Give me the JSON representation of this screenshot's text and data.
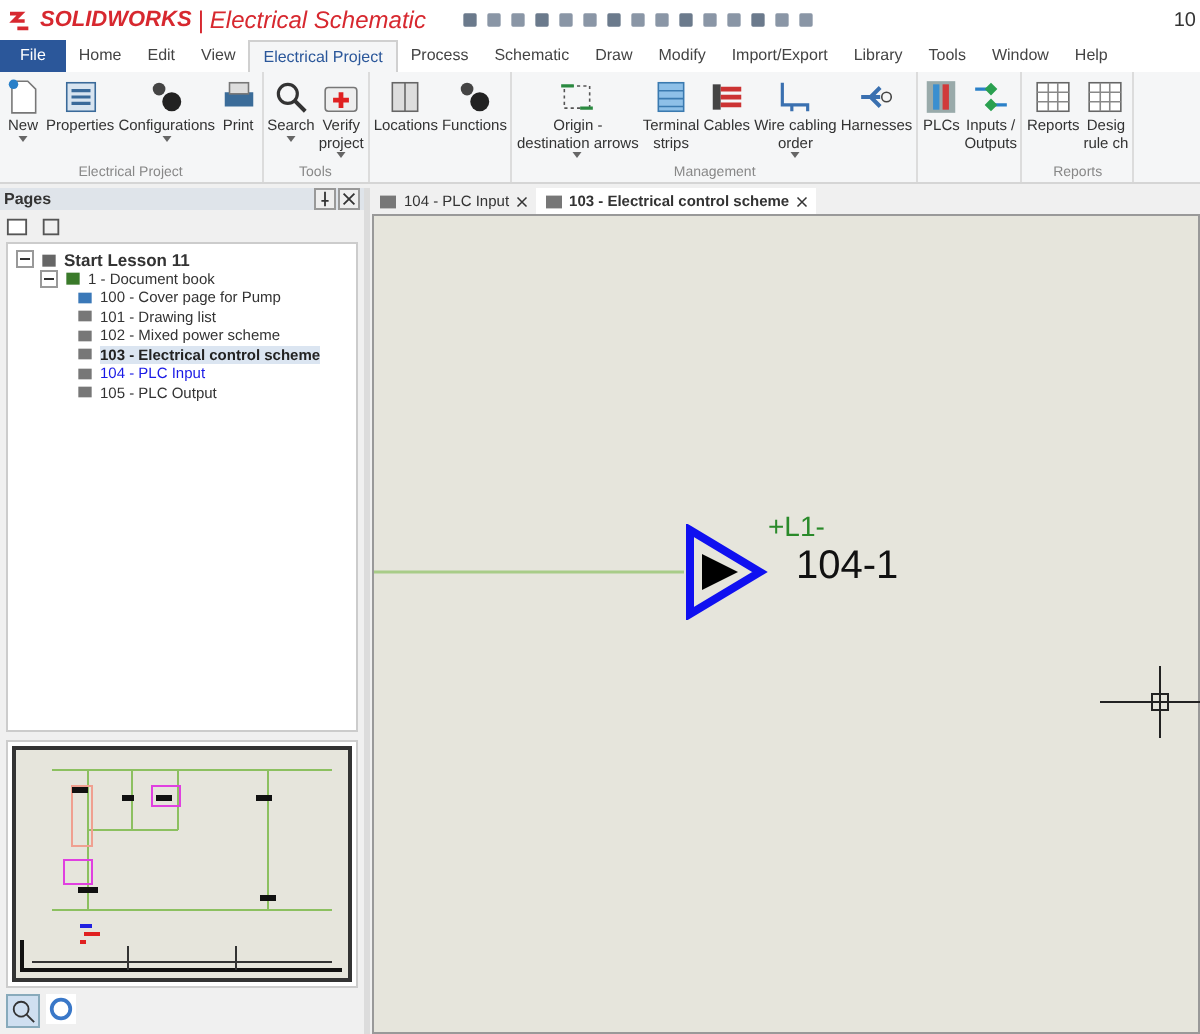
{
  "app": {
    "brand": "SOLIDWORKS",
    "separator": "|",
    "title": "Electrical Schematic",
    "corner": "10"
  },
  "menu_tabs": [
    {
      "label": "File",
      "selected": false,
      "kind": "file"
    },
    {
      "label": "Home",
      "selected": false,
      "kind": "tab"
    },
    {
      "label": "Edit",
      "selected": false,
      "kind": "tab"
    },
    {
      "label": "View",
      "selected": false,
      "kind": "tab"
    },
    {
      "label": "Electrical Project",
      "selected": true,
      "kind": "tab"
    },
    {
      "label": "Process",
      "selected": false,
      "kind": "tab"
    },
    {
      "label": "Schematic",
      "selected": false,
      "kind": "tab"
    },
    {
      "label": "Draw",
      "selected": false,
      "kind": "tab"
    },
    {
      "label": "Modify",
      "selected": false,
      "kind": "tab"
    },
    {
      "label": "Import/Export",
      "selected": false,
      "kind": "tab"
    },
    {
      "label": "Library",
      "selected": false,
      "kind": "tab"
    },
    {
      "label": "Tools",
      "selected": false,
      "kind": "tab"
    },
    {
      "label": "Window",
      "selected": false,
      "kind": "tab"
    },
    {
      "label": "Help",
      "selected": false,
      "kind": "tab"
    }
  ],
  "ribbon_groups": [
    {
      "label": "Electrical Project",
      "buttons": [
        {
          "label": "New",
          "dropdown": true
        },
        {
          "label": "Properties",
          "dropdown": false
        },
        {
          "label": "Configurations",
          "dropdown": true
        },
        {
          "label": "Print",
          "dropdown": false
        }
      ]
    },
    {
      "label": "Tools",
      "buttons": [
        {
          "label": "Search",
          "dropdown": true
        },
        {
          "label": "Verify project",
          "dropdown": true
        }
      ]
    },
    {
      "buttons": [
        {
          "label": "Locations",
          "dropdown": false
        },
        {
          "label": "Functions",
          "dropdown": false
        }
      ]
    },
    {
      "label": "Management",
      "buttons": [
        {
          "label": "Origin - destination arrows",
          "dropdown": true
        },
        {
          "label": "Terminal strips",
          "dropdown": false
        },
        {
          "label": "Cables",
          "dropdown": false
        },
        {
          "label": "Wire cabling order",
          "dropdown": true
        },
        {
          "label": "Harnesses",
          "dropdown": false
        }
      ]
    },
    {
      "buttons": [
        {
          "label": "PLCs",
          "dropdown": false
        },
        {
          "label": "Inputs / Outputs",
          "dropdown": false
        }
      ]
    },
    {
      "label": "Reports",
      "buttons": [
        {
          "label": "Reports",
          "dropdown": false
        },
        {
          "label": "Desig rule ch",
          "dropdown": false
        }
      ]
    }
  ],
  "pages_panel": {
    "title": "Pages",
    "tree": {
      "label": "Start Lesson 11",
      "expanded": true,
      "children": [
        {
          "label": "1 - Document book",
          "expanded": true,
          "children": [
            {
              "label": "100 - Cover page for Pump",
              "selected": false,
              "color": "#333333"
            },
            {
              "label": "101 - Drawing list",
              "selected": false,
              "color": "#333333"
            },
            {
              "label": "102 - Mixed power scheme",
              "selected": false,
              "color": "#333333"
            },
            {
              "label": "103 - Electrical control scheme",
              "selected": true,
              "color": "#222222"
            },
            {
              "label": "104 - PLC Input",
              "selected": false,
              "color": "#1a1ae6"
            },
            {
              "label": "105 - PLC Output",
              "selected": false,
              "color": "#333333"
            }
          ]
        }
      ]
    }
  },
  "document_tabs": [
    {
      "label": "104 - PLC Input",
      "selected": false
    },
    {
      "label": "103 - Electrical control scheme",
      "selected": true
    }
  ],
  "canvas": {
    "wire_label": "+L1-",
    "arrow_label": "104-1"
  }
}
